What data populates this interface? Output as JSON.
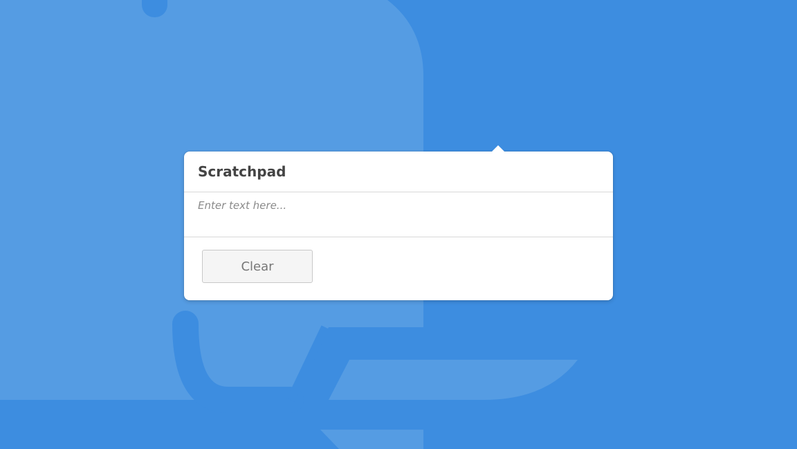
{
  "scratchpad": {
    "title": "Scratchpad",
    "input_value": "",
    "input_placeholder": "Enter text here...",
    "clear_label": "Clear"
  },
  "colors": {
    "background": "#3d8de0",
    "background_art": "#559ce3",
    "popover": "#ffffff"
  }
}
